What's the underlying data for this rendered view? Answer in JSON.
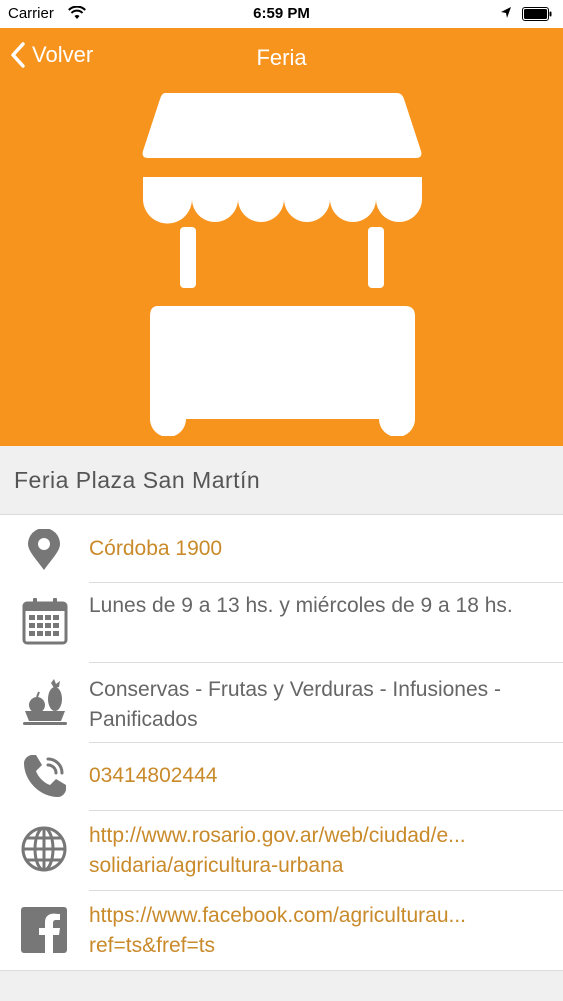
{
  "status_bar": {
    "carrier": "Carrier",
    "time": "6:59 PM"
  },
  "nav": {
    "back_label": "Volver",
    "title": "Feria"
  },
  "venue": {
    "name": "Feria Plaza San Martín"
  },
  "details": {
    "address": "Córdoba 1900",
    "hours": "Lunes de 9 a 13 hs. y miércoles de 9 a 18 hs.",
    "products": "Conservas - Frutas y Verduras - Infusiones - Panificados",
    "phone": "03414802444",
    "website_line1": "http://www.rosario.gov.ar/web/ciudad/e...",
    "website_line2": "solidaria/agricultura-urbana",
    "facebook_line1": "https://www.facebook.com/agriculturau...",
    "facebook_line2": "ref=ts&fref=ts"
  },
  "colors": {
    "accent": "#f7941e",
    "link": "#c98a2a",
    "icon": "#777777"
  },
  "icons": {
    "back": "chevron-left-icon",
    "stall": "market-stall-icon",
    "location": "map-pin-icon",
    "hours": "calendar-icon",
    "products": "fruit-basket-icon",
    "phone": "phone-icon",
    "website": "globe-icon",
    "facebook": "facebook-icon"
  }
}
